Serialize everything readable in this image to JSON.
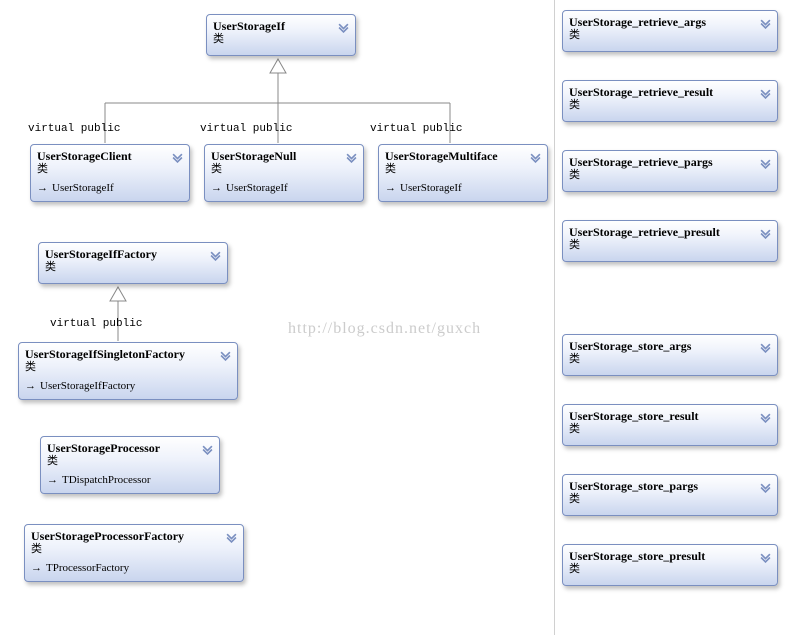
{
  "stereotype_label": "类",
  "inheritance_label": "virtual public",
  "watermark": "http://blog.csdn.net/guxch",
  "left": {
    "root": {
      "title": "UserStorageIf"
    },
    "children": [
      {
        "title": "UserStorageClient",
        "inherits": "UserStorageIf"
      },
      {
        "title": "UserStorageNull",
        "inherits": "UserStorageIf"
      },
      {
        "title": "UserStorageMultiface",
        "inherits": "UserStorageIf"
      }
    ],
    "factory_root": {
      "title": "UserStorageIfFactory"
    },
    "factory_child": {
      "title": "UserStorageIfSingletonFactory",
      "inherits": "UserStorageIfFactory"
    },
    "processor": {
      "title": "UserStorageProcessor",
      "inherits": "TDispatchProcessor"
    },
    "processor_factory": {
      "title": "UserStorageProcessorFactory",
      "inherits": "TProcessorFactory"
    }
  },
  "right_group_a": [
    {
      "title": "UserStorage_retrieve_args"
    },
    {
      "title": "UserStorage_retrieve_result"
    },
    {
      "title": "UserStorage_retrieve_pargs"
    },
    {
      "title": "UserStorage_retrieve_presult"
    }
  ],
  "right_group_b": [
    {
      "title": "UserStorage_store_args"
    },
    {
      "title": "UserStorage_store_result"
    },
    {
      "title": "UserStorage_store_pargs"
    },
    {
      "title": "UserStorage_store_presult"
    }
  ]
}
